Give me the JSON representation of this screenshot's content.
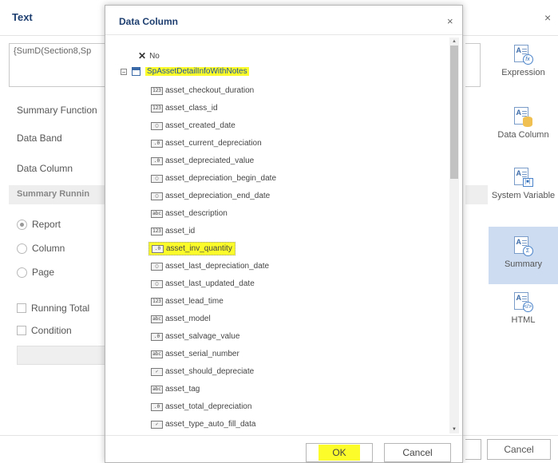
{
  "background_dialog": {
    "title": "Text",
    "close_glyph": "×",
    "expression_text": "{SumD(Section8,Sp",
    "labels": {
      "summary_function": "Summary Function",
      "data_band": "Data Band",
      "data_column": "Data Column",
      "summary_running": "Summary Runnin"
    },
    "radios": [
      {
        "label": "Report",
        "checked": true
      },
      {
        "label": "Column",
        "checked": false
      },
      {
        "label": "Page",
        "checked": false
      }
    ],
    "checkboxes": [
      {
        "label": "Running Total",
        "checked": false
      },
      {
        "label": "Condition",
        "checked": false
      }
    ],
    "cancel_label": "Cancel"
  },
  "right_toolbar": {
    "items": [
      {
        "label": "Expression",
        "icon": "expression-icon",
        "active": false
      },
      {
        "label": "Data Column",
        "icon": "data-column-icon",
        "active": false
      },
      {
        "label": "System Variable",
        "icon": "system-variable-icon",
        "active": false
      },
      {
        "label": "Summary",
        "icon": "summary-icon",
        "active": true
      },
      {
        "label": "HTML",
        "icon": "html-icon",
        "active": false
      }
    ]
  },
  "modal": {
    "title": "Data Column",
    "close_glyph": "×",
    "no_label": "No",
    "root": {
      "label": "SpAssetDetailInfoWithNotes",
      "expander": "−"
    },
    "fields": [
      {
        "name": "asset_checkout_duration",
        "type": "int"
      },
      {
        "name": "asset_class_id",
        "type": "int"
      },
      {
        "name": "asset_created_date",
        "type": "date"
      },
      {
        "name": "asset_current_depreciation",
        "type": "dec"
      },
      {
        "name": "asset_depreciated_value",
        "type": "dec"
      },
      {
        "name": "asset_depreciation_begin_date",
        "type": "date"
      },
      {
        "name": "asset_depreciation_end_date",
        "type": "date"
      },
      {
        "name": "asset_description",
        "type": "str"
      },
      {
        "name": "asset_id",
        "type": "int"
      },
      {
        "name": "asset_inv_quantity",
        "type": "dec",
        "selected": true
      },
      {
        "name": "asset_last_depreciation_date",
        "type": "date"
      },
      {
        "name": "asset_last_updated_date",
        "type": "date"
      },
      {
        "name": "asset_lead_time",
        "type": "int"
      },
      {
        "name": "asset_model",
        "type": "str"
      },
      {
        "name": "asset_salvage_value",
        "type": "dec"
      },
      {
        "name": "asset_serial_number",
        "type": "str"
      },
      {
        "name": "asset_should_depreciate",
        "type": "bool"
      },
      {
        "name": "asset_tag",
        "type": "str"
      },
      {
        "name": "asset_total_depreciation",
        "type": "dec"
      },
      {
        "name": "asset_type_auto_fill_data",
        "type": "bool"
      }
    ],
    "type_glyphs": {
      "int": "123",
      "date": "▢",
      "dec": ".0",
      "str": "abc",
      "bool": "✓"
    },
    "ok_label": "OK",
    "cancel_label": "Cancel",
    "colors": {
      "highlight": "#fcfc2a",
      "title": "#1e3f70",
      "active_tool": "#cddcf1"
    }
  }
}
